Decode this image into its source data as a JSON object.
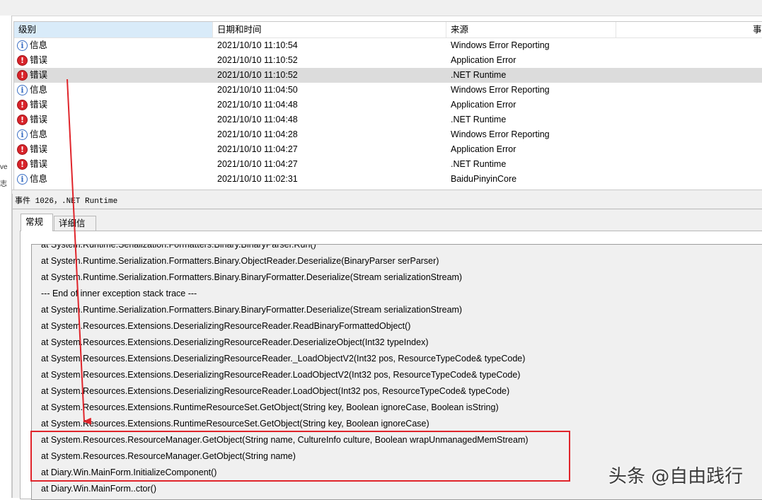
{
  "list": {
    "columns": [
      "级别",
      "日期和时间",
      "来源",
      "事件"
    ],
    "rows": [
      {
        "level": "信息",
        "type": "info",
        "datetime": "2021/10/10 11:10:54",
        "source": "Windows Error Reporting"
      },
      {
        "level": "错误",
        "type": "error",
        "datetime": "2021/10/10 11:10:52",
        "source": "Application Error"
      },
      {
        "level": "错误",
        "type": "error",
        "datetime": "2021/10/10 11:10:52",
        "source": ".NET Runtime"
      },
      {
        "level": "信息",
        "type": "info",
        "datetime": "2021/10/10 11:04:50",
        "source": "Windows Error Reporting"
      },
      {
        "level": "错误",
        "type": "error",
        "datetime": "2021/10/10 11:04:48",
        "source": "Application Error"
      },
      {
        "level": "错误",
        "type": "error",
        "datetime": "2021/10/10 11:04:48",
        "source": ".NET Runtime"
      },
      {
        "level": "信息",
        "type": "info",
        "datetime": "2021/10/10 11:04:28",
        "source": "Windows Error Reporting"
      },
      {
        "level": "错误",
        "type": "error",
        "datetime": "2021/10/10 11:04:27",
        "source": "Application Error"
      },
      {
        "level": "错误",
        "type": "error",
        "datetime": "2021/10/10 11:04:27",
        "source": ".NET Runtime"
      },
      {
        "level": "信息",
        "type": "info",
        "datetime": "2021/10/10 11:02:31",
        "source": "BaiduPinyinCore"
      }
    ],
    "selected_row": 2
  },
  "left_stub": [
    "ve",
    "志"
  ],
  "details": {
    "title": "事件 1026，.NET Runtime",
    "tabs": [
      "常规",
      "详细信息"
    ],
    "active_tab": "常规",
    "lines": [
      "at System.Runtime.Serialization.Formatters.Binary.BinaryParser.Run()",
      "at System.Runtime.Serialization.Formatters.Binary.ObjectReader.Deserialize(BinaryParser serParser)",
      "at System.Runtime.Serialization.Formatters.Binary.BinaryFormatter.Deserialize(Stream serializationStream)",
      "--- End of inner exception stack trace ---",
      "at System.Runtime.Serialization.Formatters.Binary.BinaryFormatter.Deserialize(Stream serializationStream)",
      "at System.Resources.Extensions.DeserializingResourceReader.ReadBinaryFormattedObject()",
      "at System.Resources.Extensions.DeserializingResourceReader.DeserializeObject(Int32 typeIndex)",
      "at System.Resources.Extensions.DeserializingResourceReader._LoadObjectV2(Int32 pos, ResourceTypeCode& typeCode)",
      "at System.Resources.Extensions.DeserializingResourceReader.LoadObjectV2(Int32 pos, ResourceTypeCode& typeCode)",
      "at System.Resources.Extensions.DeserializingResourceReader.LoadObject(Int32 pos, ResourceTypeCode& typeCode)",
      "at System.Resources.Extensions.RuntimeResourceSet.GetObject(String key, Boolean ignoreCase, Boolean isString)",
      "at System.Resources.Extensions.RuntimeResourceSet.GetObject(String key, Boolean ignoreCase)",
      "at System.Resources.ResourceManager.GetObject(String name, CultureInfo culture, Boolean wrapUnmanagedMemStream)",
      "at System.Resources.ResourceManager.GetObject(String name)",
      "at Diary.Win.MainForm.InitializeComponent()",
      "at Diary.Win.MainForm..ctor()"
    ]
  },
  "annotation_color": "#e0252b",
  "watermark": "头条 @自由践行"
}
